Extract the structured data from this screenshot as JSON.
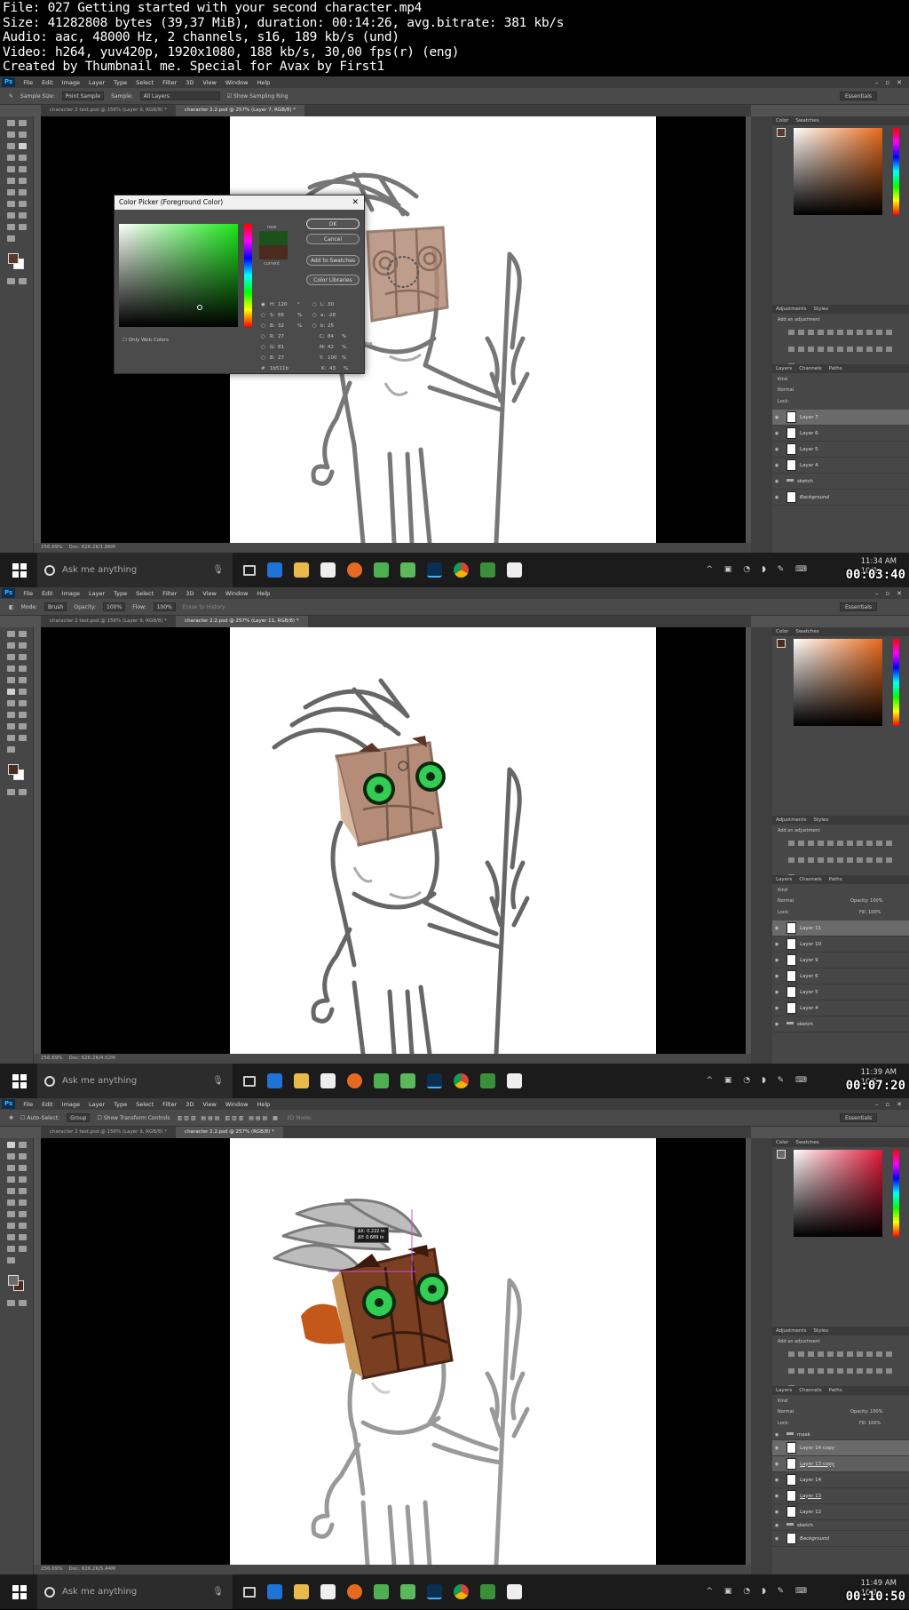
{
  "header": {
    "line1": "File: 027 Getting started with your second character.mp4",
    "line2": "Size: 41282808 bytes (39,37 MiB), duration: 00:14:26, avg.bitrate: 381 kb/s",
    "line3": "Audio: aac, 48000 Hz, 2 channels, s16, 189 kb/s (und)",
    "line4": "Video: h264, yuv420p, 1920x1080, 188 kb/s, 30,00 fps(r) (eng)",
    "line5": "Created by Thumbnail me. Special for Avax by First1"
  },
  "menu": {
    "ps": "Ps",
    "items": [
      "File",
      "Edit",
      "Image",
      "Layer",
      "Type",
      "Select",
      "Filter",
      "3D",
      "View",
      "Window",
      "Help"
    ]
  },
  "taskbar": {
    "search_placeholder": "Ask me anything",
    "date": "10/1"
  },
  "frames": [
    {
      "options": {
        "sample_size_label": "Sample Size:",
        "sample_size_value": "Point Sample",
        "sample_label": "Sample:",
        "sample_value": "All Layers",
        "show_ring": "Show Sampling Ring",
        "workspace": "Essentials"
      },
      "tabs": [
        "character 2 test.psd @ 156% (Layer 9, RGB/8) *",
        "character 2.2.psd @ 257% (Layer 7, RGB/8) *"
      ],
      "status": "256.69%",
      "status_doc": "Doc: 626.2K/1.86M",
      "clock": "11:34 AM",
      "timestamp": "00:03:40",
      "dialog": {
        "title": "Color Picker (Foreground Color)",
        "new_label": "new",
        "current_label": "current",
        "ok": "OK",
        "cancel": "Cancel",
        "add_swatches": "Add to Swatches",
        "color_libraries": "Color Libraries",
        "only_web": "Only Web Colors",
        "h": "120",
        "s": "66",
        "b": "32",
        "r": "27",
        "g": "81",
        "bb": "27",
        "l": "30",
        "a": "-28",
        "b2": "25",
        "c": "84",
        "m": "42",
        "y": "100",
        "k": "43",
        "hex": "1b511b",
        "h_label": "H:",
        "s_label": "S:",
        "b_label": "B:",
        "r_label": "R:",
        "g_label": "G:",
        "bb_label": "B:",
        "l_label": "L:",
        "a_label": "a:",
        "b2_label": "b:",
        "c_label": "C:",
        "m_label": "M:",
        "y_label": "Y:",
        "k_label": "K:",
        "deg": "°",
        "pct": "%",
        "hash": "#"
      },
      "layers": [
        "Layer 7",
        "Layer 6",
        "Layer 5",
        "Layer 4",
        "sketch",
        "Background"
      ],
      "selected_layer": 0
    },
    {
      "options": {
        "mode_label": "Mode:",
        "mode_value": "Brush",
        "opacity_label": "Opacity:",
        "opacity_value": "100%",
        "flow_label": "Flow:",
        "flow_value": "100%",
        "erase_history": "Erase to History",
        "workspace": "Essentials"
      },
      "tabs": [
        "character 2 test.psd @ 156% (Layer 9, RGB/8) *",
        "character 2.2.psd @ 257% (Layer 11, RGB/8) *"
      ],
      "status": "256.69%",
      "status_doc": "Doc: 626.2K/4.02M",
      "clock": "11:39 AM",
      "timestamp": "00:07:20",
      "layers": [
        "Layer 11",
        "Layer 10",
        "Layer 9",
        "Layer 6",
        "Layer 5",
        "Layer 4",
        "sketch"
      ],
      "selected_layer": 0
    },
    {
      "options": {
        "auto_select": "Auto-Select:",
        "group": "Group",
        "show_transform": "Show Transform Controls",
        "mode_3d": "3D Mode:",
        "workspace": "Essentials"
      },
      "tabs": [
        "character 2 test.psd @ 156% (Layer 9, RGB/8) *",
        "character 2.2.psd @ 257% (RGB/8) *"
      ],
      "status": "256.69%",
      "status_doc": "Doc: 626.2K/5.44M",
      "clock": "11:49 AM",
      "timestamp": "00:10:50",
      "tooltip_x": "ΔX: 0.222 in",
      "tooltip_y": "ΔY: 0.689 in",
      "layers": [
        "mask",
        "Layer 14 copy",
        "Layer 13 copy",
        "Layer 14",
        "Layer 13",
        "Layer 12",
        "sketch",
        "Background"
      ],
      "selected_layer": 1
    }
  ],
  "panels": {
    "color": "Color",
    "swatches": "Swatches",
    "adjustments": "Adjustments",
    "styles": "Styles",
    "add_adjustment": "Add an adjustment",
    "layers": "Layers",
    "channels": "Channels",
    "paths": "Paths",
    "kind": "Kind",
    "normal": "Normal",
    "opacity": "Opacity:",
    "opacity_value": "100%",
    "lock": "Lock:",
    "fill": "Fill:",
    "fill_value": "100%"
  },
  "colors": {
    "fg_frame1": "#5a3a2c",
    "fg_frame2": "#4a2b1e",
    "fg_frame3": "#6a6a6a",
    "eye_green": "#33cc55",
    "wood_light": "#b48c78",
    "wood_dark": "#7a3e22"
  }
}
